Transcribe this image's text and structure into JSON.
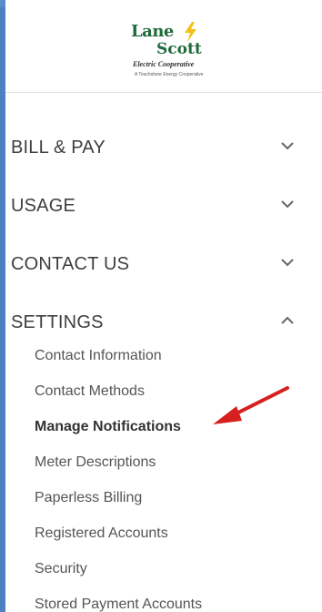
{
  "logo": {
    "line1": "Lane",
    "line2": "Scott",
    "line3": "Electric Cooperative",
    "line4": "A Touchstone Energy Cooperative"
  },
  "menu": {
    "sections": [
      {
        "label": "BILL & PAY",
        "expanded": false
      },
      {
        "label": "USAGE",
        "expanded": false
      },
      {
        "label": "CONTACT US",
        "expanded": false
      },
      {
        "label": "SETTINGS",
        "expanded": true
      }
    ],
    "settings_items": [
      {
        "label": "Contact Information"
      },
      {
        "label": "Contact Methods"
      },
      {
        "label": "Manage Notifications",
        "active": true
      },
      {
        "label": "Meter Descriptions"
      },
      {
        "label": "Paperless Billing"
      },
      {
        "label": "Registered Accounts"
      },
      {
        "label": "Security"
      },
      {
        "label": "Stored Payment Accounts"
      }
    ]
  },
  "colors": {
    "background": "#4d7fc2",
    "panel": "#ffffff",
    "text": "#3f3f3f",
    "annotation_arrow": "#d62020",
    "logo_green": "#1f6a3b",
    "logo_yellow": "#f2c21b"
  },
  "icons": {
    "collapsed": "chevron-down-icon",
    "expanded": "chevron-up-icon"
  }
}
